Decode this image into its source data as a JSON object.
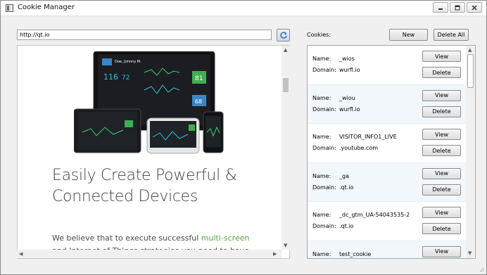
{
  "window": {
    "title": "Cookie Manager",
    "controls": {
      "minimize": "minimize-icon",
      "restore": "restore-icon",
      "close": "close-icon"
    }
  },
  "browser": {
    "url": "http://qt.io",
    "headline_line1": "Easily Create Powerful &",
    "headline_line2": "Connected Devices",
    "para_start": "We believe that to execute successful ",
    "para_link": "multi-screen",
    "para_end": "and Internet of Things strategies you need to have"
  },
  "hero_screen": {
    "patient": "Doe, Johnny M.",
    "bp_main": "116",
    "bp_sub": "72",
    "pulse": "81",
    "spo2": "68"
  },
  "cookies": {
    "label": "Cookies:",
    "new_label": "New",
    "delete_all_label": "Delete All",
    "name_key": "Name:",
    "domain_key": "Domain:",
    "view_label": "View",
    "delete_label": "Delete",
    "items": [
      {
        "name": "_wios",
        "domain": "wurfl.io"
      },
      {
        "name": "_wiou",
        "domain": "wurfl.io"
      },
      {
        "name": "VISITOR_INFO1_LIVE",
        "domain": ".youtube.com"
      },
      {
        "name": "_ga",
        "domain": ".qt.io"
      },
      {
        "name": "_dc_gtm_UA-54043535-2",
        "domain": ".qt.io"
      },
      {
        "name": "test_cookie",
        "domain": ""
      }
    ]
  },
  "colors": {
    "link_green": "#5aa34b",
    "row_alt": "#f2f7fc",
    "headline": "#404244"
  }
}
